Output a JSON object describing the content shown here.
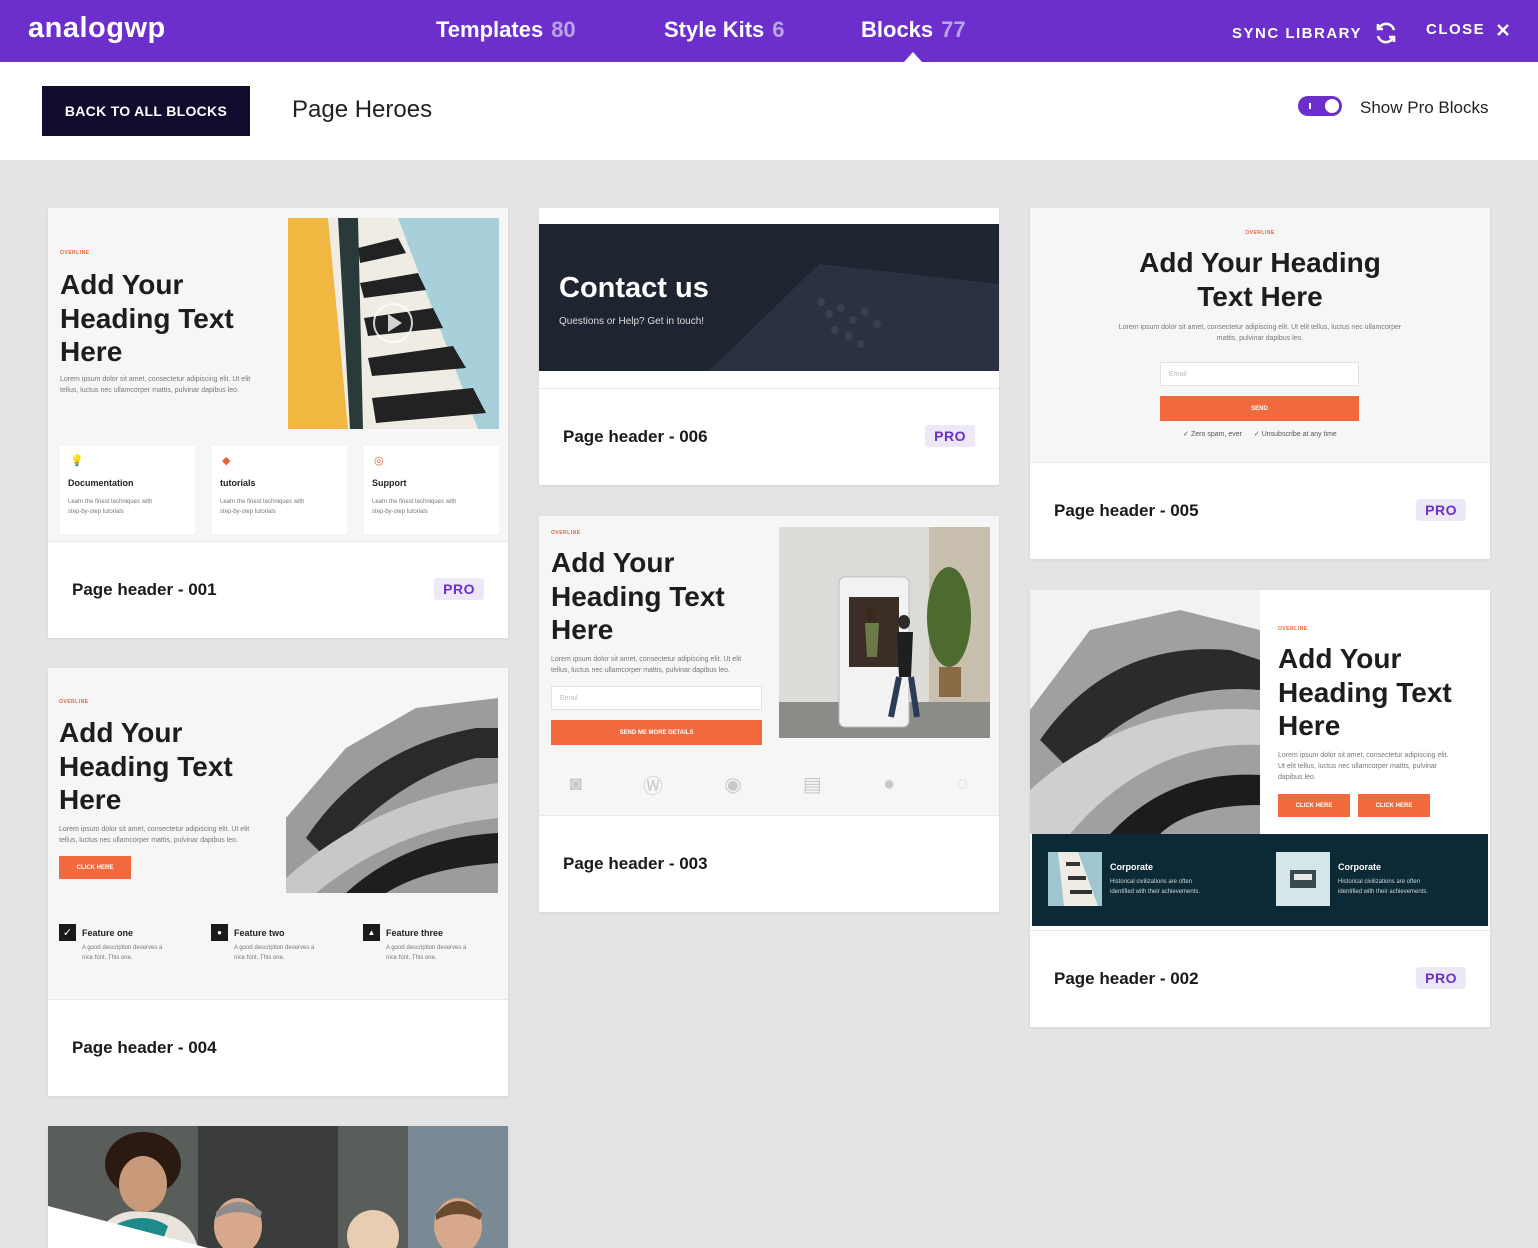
{
  "topbar": {
    "logo": "analogwp",
    "tabs": [
      {
        "label": "Templates",
        "count": "80"
      },
      {
        "label": "Style Kits",
        "count": "6"
      },
      {
        "label": "Blocks",
        "count": "77",
        "active": true
      }
    ],
    "sync_label": "SYNC LIBRARY",
    "close_label": "CLOSE"
  },
  "subheader": {
    "back_label": "BACK TO ALL BLOCKS",
    "title": "Page Heroes",
    "toggle_label": "Show Pro Blocks",
    "toggle_on": true
  },
  "colors": {
    "brand": "#6c2fcb",
    "accent": "#f06a3d",
    "dark": "#0f0c2e"
  },
  "previews": {
    "overline": "OVERLINE",
    "heading_a": "Add Your",
    "heading_b": "Heading Text",
    "heading_c": "Here",
    "heading_wide_a": "Add Your Heading",
    "heading_wide_b": "Text Here",
    "lorem_a": "Lorem ipsum dolor sit amet, consectetur adipiscing elit. Ut elit",
    "lorem_b": "tellus, luctus nec ullamcorper mattis, pulvinar dapibus leo.",
    "lorem_wide_a": "Lorem ipsum dolor sit amet, consectetur adipiscing elit. Ut elit tellus, luctus nec ullamcorper",
    "lorem_wide_b": "mattis, pulvinar dapibus leo.",
    "lorem_narrow_a": "Lorem ipsum dolor sit amet, consectetur adipiscing elit.",
    "lorem_narrow_b": "Ut elit tellus, luctus nec ullamcorper mattis, pulvinar",
    "lorem_narrow_c": "dapibus leo.",
    "email_placeholder": "Email",
    "send_label": "SEND",
    "send_details_label": "SEND ME MORE DETAILS",
    "click_label": "CLICK HERE",
    "check_a": "✓ Zero spam, ever",
    "check_b": "✓ Unsubscribe at any time",
    "contact_title": "Contact us",
    "contact_sub": "Questions or Help? Get in touch!",
    "features1": [
      {
        "title": "Documentation",
        "icon": "bulb-icon",
        "glyph": "💡",
        "desc_a": "Learn the finest techniques with",
        "desc_b": "step-by-step tutorials"
      },
      {
        "title": "tutorials",
        "icon": "gem-icon",
        "glyph": "◆",
        "desc_a": "Learn the finest techniques with",
        "desc_b": "step-by-step tutorials"
      },
      {
        "title": "Support",
        "icon": "globe-icon",
        "glyph": "◎",
        "desc_a": "Learn the finest techniques with",
        "desc_b": "step-by-step tutorials"
      }
    ],
    "features4": [
      {
        "title": "Feature one",
        "icon": "check-icon",
        "glyph": "✓",
        "desc_a": "A good description deserves a",
        "desc_b": "nice font. This one."
      },
      {
        "title": "Feature two",
        "icon": "pin-icon",
        "glyph": "●",
        "desc_a": "A good description deserves a",
        "desc_b": "nice font. This one."
      },
      {
        "title": "Feature three",
        "icon": "user-icon",
        "glyph": "▲",
        "desc_a": "A good description deserves a",
        "desc_b": "nice font. This one."
      }
    ],
    "corporate": [
      {
        "title": "Corporate",
        "desc_a": "Historical civilizations are often",
        "desc_b": "identified with their achievements."
      },
      {
        "title": "Corporate",
        "desc_a": "Historical civilizations are often",
        "desc_b": "identified with their achievements."
      }
    ]
  },
  "cards": [
    {
      "name": "Page header - 001",
      "pro": "PRO"
    },
    {
      "name": "Page header - 006",
      "pro": "PRO"
    },
    {
      "name": "Page header - 005",
      "pro": "PRO"
    },
    {
      "name": "Page header - 003"
    },
    {
      "name": "Page header - 004"
    },
    {
      "name": "Page header - 002",
      "pro": "PRO"
    }
  ]
}
